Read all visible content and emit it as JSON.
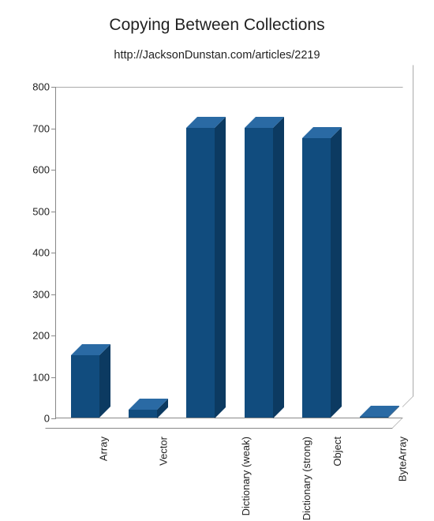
{
  "chart_data": {
    "type": "bar",
    "title": "Copying Between Collections",
    "subtitle": "http://JacksonDunstan.com/articles/2219",
    "categories": [
      "Array",
      "Vector",
      "Dictionary (weak)",
      "Dictionary (strong)",
      "Object",
      "ByteArray"
    ],
    "values": [
      150,
      20,
      700,
      700,
      675,
      2
    ],
    "ylim": [
      0,
      800
    ],
    "yticks": [
      0,
      100,
      200,
      300,
      400,
      500,
      600,
      700,
      800
    ],
    "xlabel": "",
    "ylabel": ""
  },
  "style": {
    "bar_fill": "#114c7e",
    "bar_side": "#0c3a61",
    "bar_top": "#2a6aa4"
  }
}
